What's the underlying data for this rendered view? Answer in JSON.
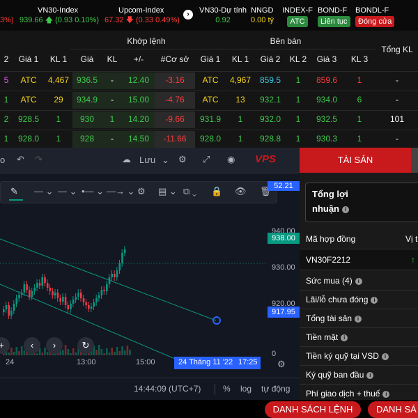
{
  "indexbar": {
    "items": [
      {
        "name": "",
        "value": "3%)",
        "change": ""
      },
      {
        "name": "VN30-Index",
        "value": "939.66",
        "change": "(0.93 0.10%)"
      },
      {
        "name": "Upcom-Index",
        "value": "67.32",
        "change": "(0.33 0.49%)"
      },
      {
        "name": "VN30-Dự tính",
        "value": "0.92"
      },
      {
        "name": "NNGD",
        "value": "0.00 tỷ"
      },
      {
        "name": "INDEX-F",
        "value": "ATC"
      },
      {
        "name": "BOND-F",
        "value": "Liên tục"
      },
      {
        "name": "BONDL-F",
        "value": "Đóng cửa"
      }
    ],
    "colors": {
      "atc": "#2b8a3e",
      "lientuc": "#2b8a3e",
      "dongcua": "#c8191d"
    }
  },
  "board": {
    "group_khop": "Khớp lệnh",
    "group_ben_ban": "Bên bán",
    "tong_kl": "Tổng KL",
    "headers": [
      "2",
      "Giá 1",
      "KL 1",
      "Giá",
      "KL",
      "+/-",
      "#Cơ sở",
      "Giá 1",
      "KL 1",
      "Giá 2",
      "KL 2",
      "Giá 3",
      "KL 3"
    ],
    "rows": [
      [
        "5",
        "ATC",
        "4,467",
        "936.5",
        "-",
        "12.40",
        "-3.16",
        "ATC",
        "4,967",
        "859.5",
        "1",
        "859.6",
        "1",
        "-"
      ],
      [
        "1",
        "ATC",
        "29",
        "934.9",
        "-",
        "15.00",
        "-4.76",
        "ATC",
        "13",
        "932.1",
        "1",
        "934.0",
        "6",
        "-"
      ],
      [
        "2",
        "928.5",
        "1",
        "930",
        "1",
        "14.20",
        "-9.66",
        "931.9",
        "1",
        "932.0",
        "1",
        "932.5",
        "1",
        "101"
      ],
      [
        "1",
        "928.0",
        "1",
        "928",
        "-",
        "14.50",
        "-11.66",
        "928.0",
        "1",
        "928.8",
        "1",
        "930.3",
        "1",
        "-"
      ]
    ]
  },
  "chart": {
    "toolbar_left": "o",
    "save_label": "Lưu",
    "logo": "VPS",
    "price_labels": [
      "52.21",
      "940.00",
      "930.00",
      "920.00",
      "0"
    ],
    "last_price": "938.00",
    "line_price": "917.95",
    "time_labels": [
      "24",
      "13:00",
      "15:00"
    ],
    "time_highlight": "24 Tháng 11 '22",
    "time_highlight_clock": "17:25",
    "clock": "14:44:09 (UTC+7)",
    "pct": "%",
    "log": "log",
    "auto": "tự động",
    "accent": "#089981",
    "bear": "#f23645"
  },
  "right_panel": {
    "tab_label": "TÀI SẢN",
    "pl_title_1": "Tổng lợi",
    "pl_title_2": "nhuận",
    "header_left": "Mã hợp đồng",
    "header_right": "Vị t",
    "contract": "VN30F2212",
    "items": [
      "Sức mua (4)",
      "Lãi/lỗ chưa đóng",
      "Tổng tài sản",
      "Tiền mặt",
      "Tiền ký quỹ tại VSD",
      "Ký quỹ ban đầu",
      "Phí giao dịch + thuế"
    ]
  },
  "bottom": {
    "btn1": "DANH SÁCH LỆNH",
    "btn2": "DANH SÁ"
  }
}
